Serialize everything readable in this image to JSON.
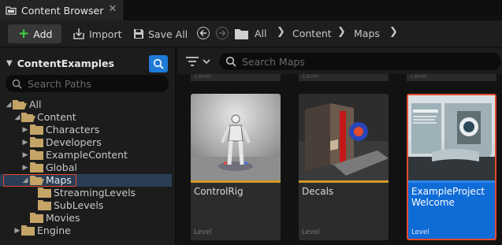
{
  "tab": {
    "title": "Content Browser",
    "close_glyph": "✕",
    "icon": "content-browser-icon"
  },
  "toolbar": {
    "add_label": "Add",
    "import_label": "Import",
    "save_all_label": "Save All",
    "breadcrumbs": [
      "All",
      "Content",
      "Maps"
    ]
  },
  "sources": {
    "root_label": "ContentExamples",
    "search_placeholder": "Search Paths",
    "tree": [
      {
        "label": "All",
        "level": 0,
        "expanded": true
      },
      {
        "label": "Content",
        "level": 1,
        "expanded": true
      },
      {
        "label": "Characters",
        "level": 2,
        "expanded": false
      },
      {
        "label": "Developers",
        "level": 2,
        "expanded": false
      },
      {
        "label": "ExampleContent",
        "level": 2,
        "expanded": false
      },
      {
        "label": "Global",
        "level": 2,
        "expanded": false
      },
      {
        "label": "Maps",
        "level": 2,
        "expanded": true,
        "selected": true
      },
      {
        "label": "StreamingLevels",
        "level": 3
      },
      {
        "label": "SubLevels",
        "level": 3
      },
      {
        "label": "Movies",
        "level": 2
      },
      {
        "label": "Engine",
        "level": 1,
        "expanded": false
      }
    ]
  },
  "assets": {
    "search_placeholder": "Search Maps",
    "previous_row_type": "Level",
    "cards": [
      {
        "name": "ControlRig",
        "type": "Level"
      },
      {
        "name": "Decals",
        "type": "Level"
      },
      {
        "name": "ExampleProject Welcome",
        "type": "Level",
        "selected": true
      }
    ]
  },
  "colors": {
    "accent": "#1f7ad8",
    "selection_outline": "#e34a2e",
    "level_bar": "#d29a25",
    "add_plus": "#3ed33e"
  }
}
